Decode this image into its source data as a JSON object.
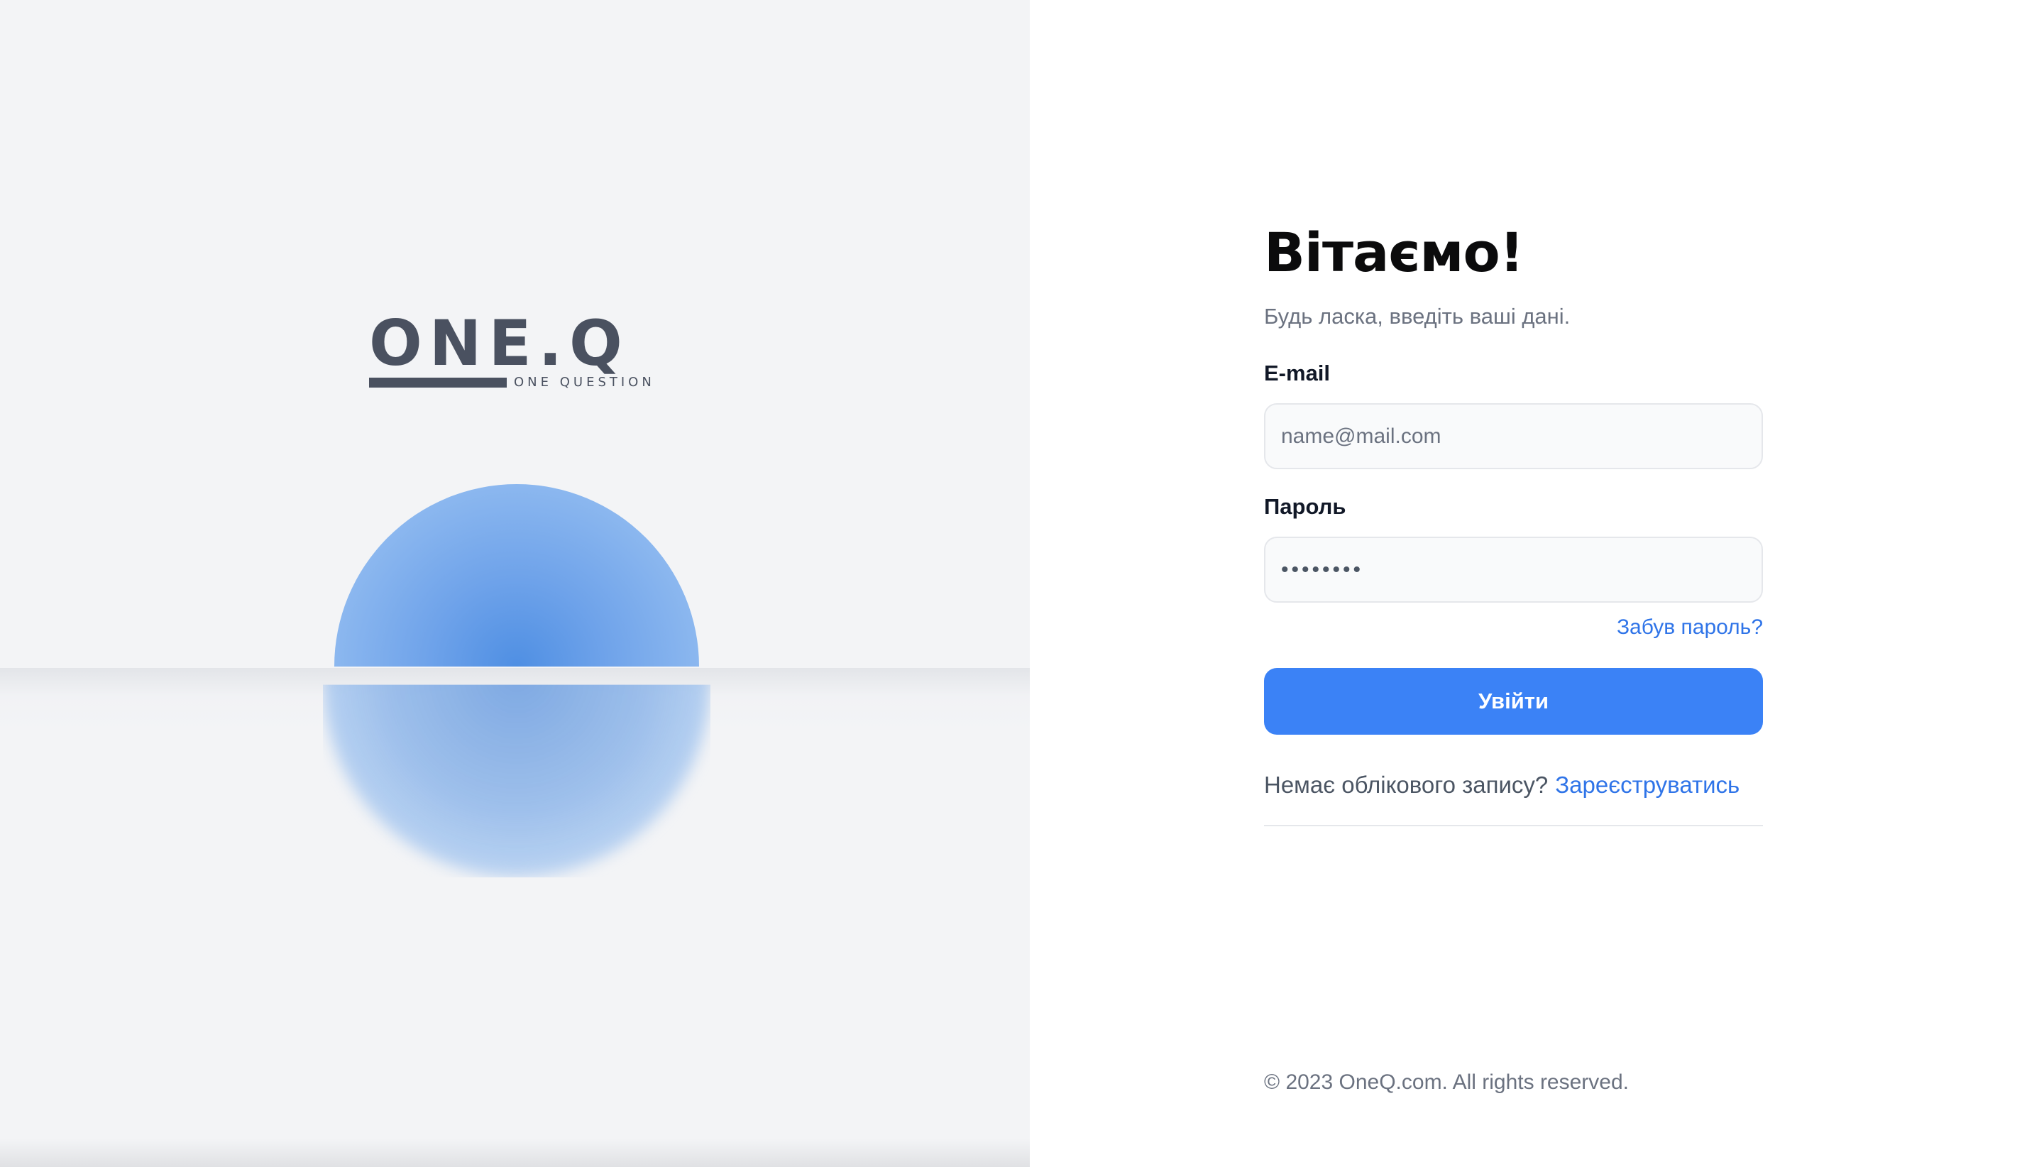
{
  "brand": {
    "logo_mark": "ONE.Q",
    "logo_tagline": "ONE QUESTION"
  },
  "login": {
    "title": "Вітаємо!",
    "subtitle": "Будь ласка, введіть ваші дані.",
    "email_label": "E-mail",
    "email_placeholder": "name@mail.com",
    "email_value": "",
    "password_label": "Пароль",
    "password_value": "••••••••",
    "forgot_link": "Забув пароль?",
    "submit_label": "Увійти",
    "no_account_text": "Немає облікового запису?",
    "register_link": "Зареєструватись"
  },
  "footer": {
    "copyright": "© 2023 OneQ.com. All rights reserved."
  },
  "colors": {
    "accent": "#3b82f6",
    "link": "#2f74e8",
    "left_panel_bg": "#f3f4f6",
    "logo_color": "#4a5160",
    "sphere_color": "#4f8fe3"
  }
}
